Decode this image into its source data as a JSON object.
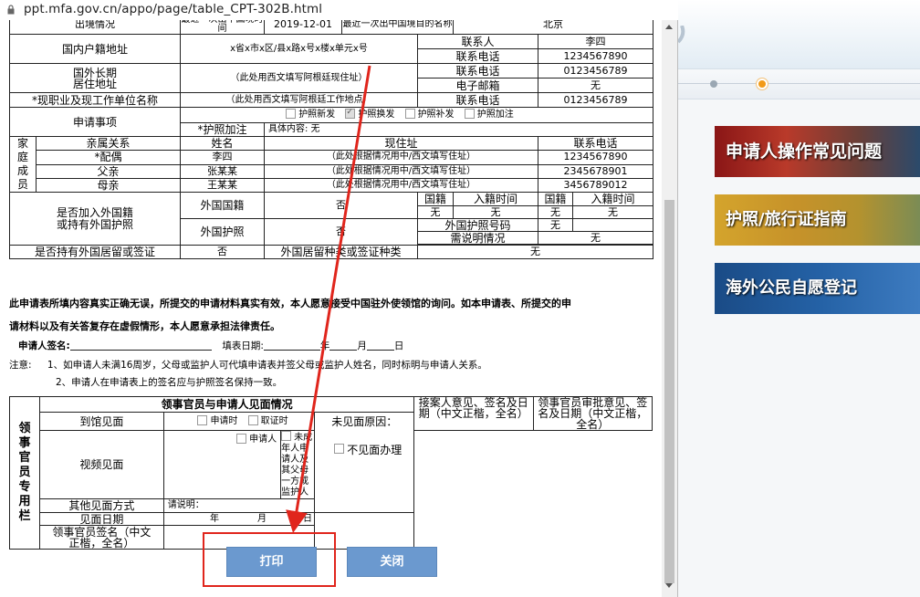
{
  "browser": {
    "url": "ppt.mfa.gov.cn/appo/page/table_CPT-302B.html"
  },
  "form": {
    "row0": {
      "label_a": "出境情况",
      "label_b": "最近一次出中国境时间",
      "date": "2019-12-01",
      "label_c": "最近一次出中国境目的名称",
      "city": "北京"
    },
    "domestic_addr_label": "国内户籍地址",
    "domestic_addr": "x省x市x区/县x路x号x楼x单元x号",
    "contact_label": "联系人",
    "contact": "李四",
    "contact_phone_label": "联系电话",
    "contact_phone": "1234567890",
    "foreign_addr_label": "国外长期居住地址",
    "foreign_addr": "（此处用西文填写阿根廷现住址）",
    "phone_label": "联系电话",
    "phone": "0123456789",
    "email_label": "电子邮箱",
    "email": "无",
    "job_label": "*现职业及现工作单位名称",
    "job": "（此处用西文填写阿根廷工作地点）",
    "job_phone_label": "联系电话",
    "job_phone": "0123456789",
    "apply_label": "申请事项",
    "apply_options": [
      "护照新发",
      "护照换发",
      "护照补发",
      "护照加注"
    ],
    "passport_add_label": "*护照加注",
    "passport_add": "具体内容: 无",
    "family": {
      "side_label": "家庭成员",
      "headers": [
        "亲属关系",
        "姓名",
        "现住址",
        "联系电话"
      ],
      "rows": [
        {
          "relation": "*配偶",
          "name": "李四",
          "addr": "（此处根据情况用中/西文填写住址）",
          "phone": "1234567890"
        },
        {
          "relation": "父亲",
          "name": "张某某",
          "addr": "（此处根据情况用中/西文填写住址）",
          "phone": "2345678901"
        },
        {
          "relation": "母亲",
          "name": "王某某",
          "addr": "（此处根据情况用中/西文填写住址）",
          "phone": "3456789012"
        }
      ]
    },
    "foreign": {
      "label": "是否加入外国籍或持有外国护照",
      "nationality_label": "外国国籍",
      "nationality": "否",
      "nat_h1": "国籍",
      "nat_h2": "入籍时间",
      "nat_h3": "国籍",
      "nat_h4": "入籍时间",
      "nat_v1": "无",
      "nat_v2": "无",
      "nat_v3": "无",
      "nat_v4": "无",
      "passport_label": "外国护照",
      "passport": "否",
      "pp_no_label": "外国护照号码",
      "pp_no": "无",
      "explain_label": "需说明情况",
      "explain": "无"
    },
    "residence": {
      "label": "是否持有外国居留或签证",
      "value": "否",
      "type_label": "外国居留种类或签证种类",
      "type_value": "无"
    },
    "statement1": "此申请表所填内容真实正确无误，所提交的申请材料真实有效，本人愿意接受中国驻外使领馆的询问。如本申请表、所提交的申",
    "statement2": "请材料以及有关答复存在虚假情形，本人愿意承担法律责任。",
    "sign_label": "申请人签名:",
    "fill_date_label": "填表日期:",
    "y": "年",
    "m": "月",
    "d": "日",
    "note_label": "注意:",
    "note1": "1、如申请人未满16周岁，父母或监护人可代填申请表并签父母或监护人姓名，同时标明与申请人关系。",
    "note2": "2、申请人在申请表上的签名应与护照签名保持一致。",
    "consular": {
      "side_label": "领事官员专用栏",
      "title": "领事官员与申请人见面情况",
      "reception": "接案人意见、签名及日期（中文正楷，全名）",
      "approval": "领事官员审批意见、签名及日期（中文正楷，全名）",
      "visit_label": "到馆见面",
      "visit_opt1": "申请时",
      "visit_opt2": "取证时",
      "absence_label": "未见面原因：",
      "video_label": "视频见面",
      "video_opt1": "申请人",
      "video_opt2": "未成年人申请人及其父母一方或监护人",
      "no_meet": "不见面办理",
      "other_label": "其他见面方式",
      "other_value": "请说明：",
      "date_label": "见面日期",
      "y": "年",
      "m": "月",
      "d": "日",
      "officer_sign": "领事官员签名（中文正楷，全名）"
    }
  },
  "buttons": {
    "print": "打印",
    "close": "关闭"
  },
  "sidebar": {
    "banners": [
      "申请人操作常见问题",
      "护照/旅行证指南",
      "海外公民自愿登记"
    ]
  },
  "colors": {
    "button": "#6b99cf",
    "highlight": "#e0251c",
    "arrow": "#e0251c"
  }
}
